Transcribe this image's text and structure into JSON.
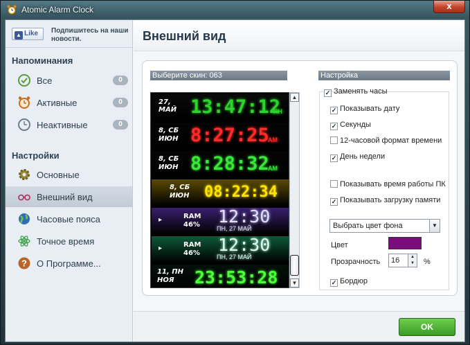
{
  "window": {
    "title": "Atomic Alarm Clock",
    "close_glyph": "x"
  },
  "sidebar": {
    "like_label": "Like",
    "like_text": "Подпишитесь на наши новости.",
    "reminders_header": "Напоминания",
    "reminders": [
      {
        "label": "Все",
        "count": "0",
        "icon": "checkmark-clock-icon",
        "color": "#5a9b3c"
      },
      {
        "label": "Активные",
        "count": "0",
        "icon": "alarm-clock-icon",
        "color": "#c86f1e"
      },
      {
        "label": "Неактивные",
        "count": "0",
        "icon": "clock-icon",
        "color": "#6b7e8c"
      }
    ],
    "settings_header": "Настройки",
    "settings": [
      {
        "label": "Основные",
        "icon": "gear-icon"
      },
      {
        "label": "Внешний вид",
        "icon": "glasses-icon",
        "active": true
      },
      {
        "label": "Часовые пояса",
        "icon": "globe-icon"
      },
      {
        "label": "Точное время",
        "icon": "atom-icon"
      },
      {
        "label": "О Программе...",
        "icon": "question-icon"
      }
    ]
  },
  "main": {
    "title": "Внешний вид",
    "skin_header": "Выберите скин: 063",
    "settings_header": "Настройка",
    "skins": [
      {
        "sub1": "27,",
        "sub2": "МАЙ",
        "time": "13:47:12",
        "suffix": "ПН",
        "color": "#2fd12f",
        "bg": "#0a0a0a"
      },
      {
        "sub1": "8, СБ",
        "sub2": "ИЮН",
        "time": "8:27:25",
        "suffix": "AM",
        "color": "#ff2a2a",
        "bg": "#050505"
      },
      {
        "sub1": "8, СБ",
        "sub2": "ИЮН",
        "time": "8:28:32",
        "suffix": "AM",
        "color": "#39e639",
        "bg": "#050505"
      },
      {
        "sub1": "8, СБ",
        "sub2": "ИЮН",
        "time": "08:22:34",
        "suffix": "",
        "color": "#ffe400",
        "bg": "#5a4a00"
      },
      {
        "sub1": "RAM",
        "sub2": "46%",
        "time": "12:30",
        "suffix": "ПН, 27 МАЙ",
        "color": "#e0e0ff",
        "bg": "#3a1f6e"
      },
      {
        "sub1": "RAM",
        "sub2": "46%",
        "time": "12:30",
        "suffix": "ПН, 27 МАЙ",
        "color": "#d8fff0",
        "bg": "#0d5a3a"
      },
      {
        "sub1": "11, ПН",
        "sub2": "НОЯ",
        "time": "23:53:28",
        "suffix": "",
        "color": "#4dff3a",
        "bg": "#04100a"
      }
    ],
    "replace_clock": {
      "label": "Заменять часы",
      "checked": true
    },
    "options": [
      {
        "label": "Показывать дату",
        "checked": true
      },
      {
        "label": "Секунды",
        "checked": true
      },
      {
        "label": "12-часовой формат времени",
        "checked": false
      },
      {
        "label": "День недели",
        "checked": true
      },
      {
        "label": "Показывать время работы ПК",
        "checked": false
      },
      {
        "label": "Показывать загрузку памяти",
        "checked": true
      }
    ],
    "bg_select": "Выбрать цвет фона",
    "color_label": "Цвет",
    "color_value": "#7a0c7e",
    "transparency_label": "Прозрачность",
    "transparency_value": "16",
    "transparency_unit": "%",
    "border": {
      "label": "Бордюр",
      "checked": true
    },
    "ok_label": "OK"
  }
}
